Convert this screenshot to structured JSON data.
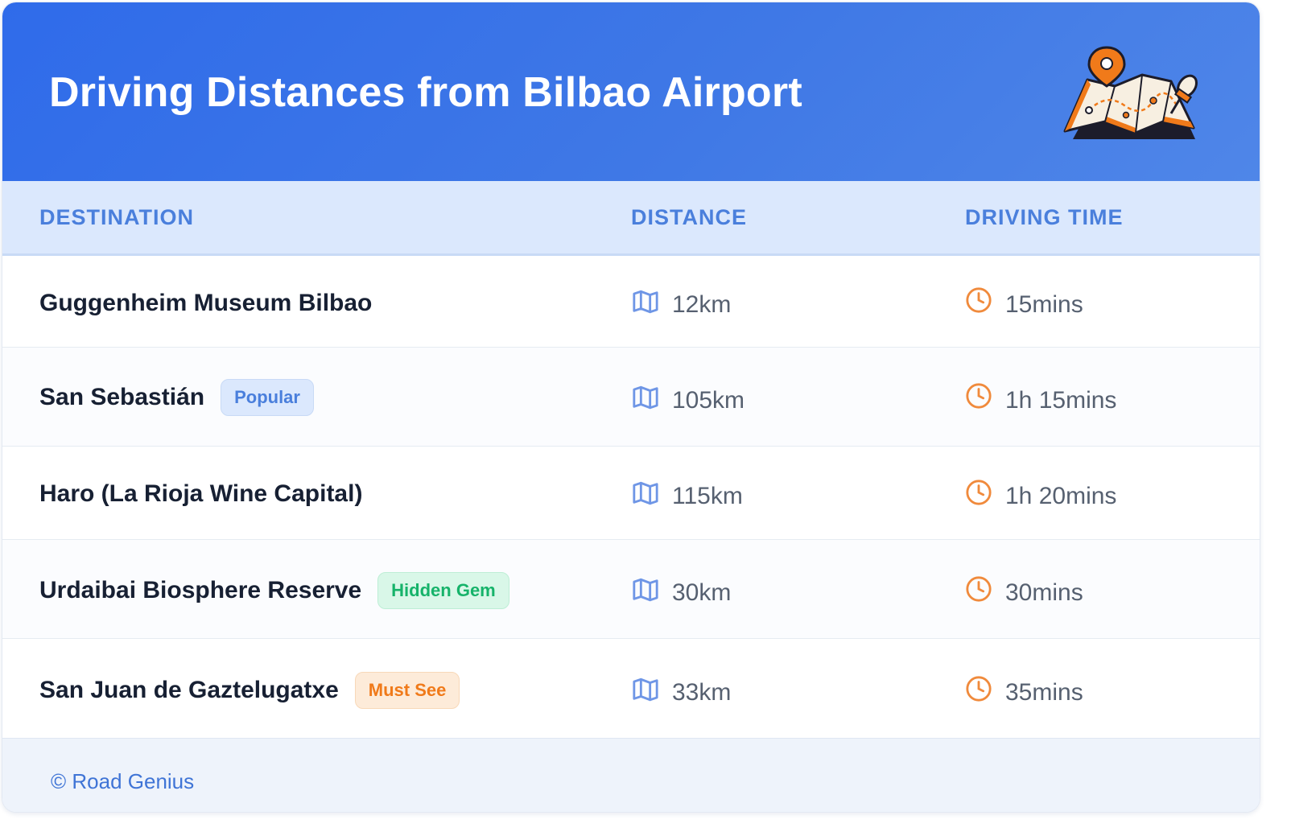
{
  "header": {
    "title": "Driving Distances from Bilbao Airport",
    "illustration": "map-with-pins-icon"
  },
  "table": {
    "columns": [
      "DESTINATION",
      "DISTANCE",
      "DRIVING TIME"
    ],
    "rows": [
      {
        "destination": "Guggenheim Museum Bilbao",
        "badge": "",
        "distance": "12km",
        "time": "15mins"
      },
      {
        "destination": "San Sebastián",
        "badge": "Popular",
        "distance": "105km",
        "time": "1h 15mins"
      },
      {
        "destination": "Haro (La Rioja Wine Capital)",
        "badge": "",
        "distance": "115km",
        "time": "1h 20mins"
      },
      {
        "destination": "Urdaibai Biosphere Reserve",
        "badge": "Hidden Gem",
        "distance": "30km",
        "time": "30mins"
      },
      {
        "destination": "San Juan de Gaztelugatxe",
        "badge": "Must See",
        "distance": "33km",
        "time": "35mins"
      }
    ]
  },
  "footer": {
    "copyright": "© Road Genius"
  },
  "colors": {
    "header_gradient_start": "#2f6bea",
    "header_gradient_end": "#4f86e8",
    "column_header_text": "#4a7fdc",
    "map_icon": "#6f96e6",
    "clock_icon": "#f08a3c",
    "badge_popular": "#4a7fdc",
    "badge_hidden_gem": "#16b36a",
    "badge_must_see": "#f07a1a"
  }
}
